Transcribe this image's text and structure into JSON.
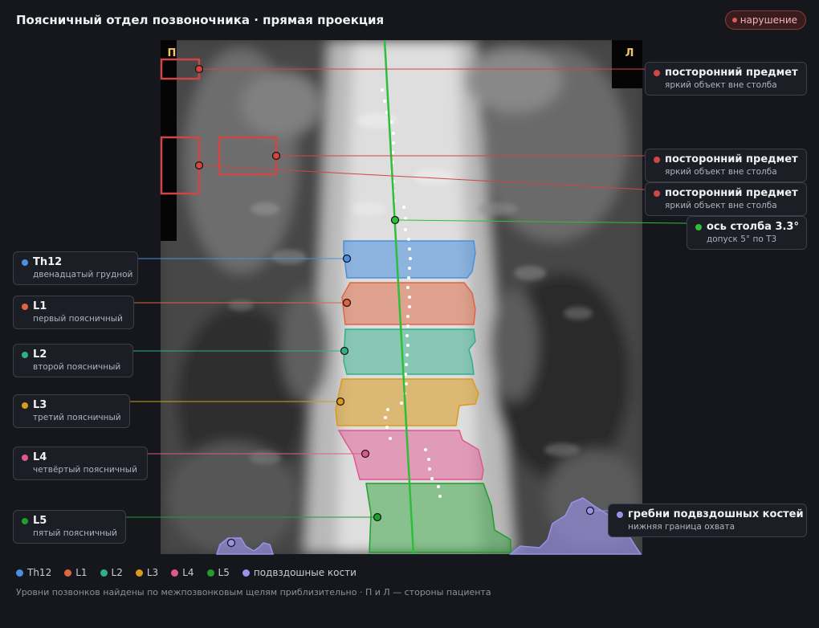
{
  "header": {
    "title": "Поясничный отдел позвоночника · прямая проекция",
    "badge": "нарушение"
  },
  "image": {
    "side_right": "П",
    "side_left": "Л"
  },
  "annotations": {
    "foreign1": {
      "title": "посторонний предмет",
      "subtitle": "яркий объект вне столба"
    },
    "foreign2": {
      "title": "посторонний предмет",
      "subtitle": "яркий объект вне столба"
    },
    "foreign3": {
      "title": "посторонний предмет",
      "subtitle": "яркий объект вне столба"
    },
    "axis": {
      "title": "ось столба 3.3°",
      "subtitle": "допуск 5° по Т3"
    },
    "iliac": {
      "title": "гребни подвздошных костей",
      "subtitle": "нижняя граница охвата"
    },
    "th12": {
      "title": "Th12",
      "subtitle": "двенадцатый грудной"
    },
    "l1": {
      "title": "L1",
      "subtitle": "первый поясничный"
    },
    "l2": {
      "title": "L2",
      "subtitle": "второй поясничный"
    },
    "l3": {
      "title": "L3",
      "subtitle": "третий поясничный"
    },
    "l4": {
      "title": "L4",
      "subtitle": "четвёртый поясничный"
    },
    "l5": {
      "title": "L5",
      "subtitle": "пятый поясничный"
    }
  },
  "legend": [
    "Th12",
    "L1",
    "L2",
    "L3",
    "L4",
    "L5",
    "подвздошные кости"
  ],
  "footnote": "Уровни позвонков найдены по межпозвонковым щелям приблизительно · П и Л — стороны пациента",
  "colors": {
    "th12": "#4a8fe0",
    "l1": "#e0653f",
    "l2": "#2fb08a",
    "l3": "#d99a1e",
    "l4": "#e0578f",
    "l5": "#1f9e2c",
    "iliac": "#9a92e8",
    "foreign": "#d04545",
    "axis": "#2dbf3a"
  }
}
